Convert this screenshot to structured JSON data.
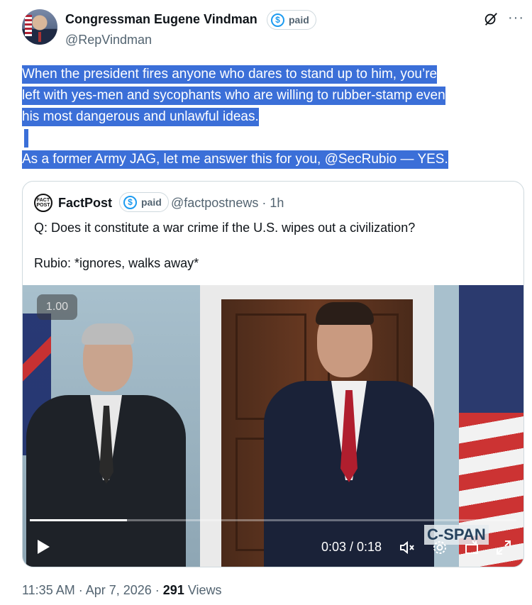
{
  "author": {
    "name": "Congressman Eugene Vindman",
    "badge_label": "paid",
    "badge_symbol": "$",
    "handle": "@RepVindman"
  },
  "tweet": {
    "lines": [
      "When the president fires anyone who dares to stand up to him, you’re",
      "left with yes-men and sycophants who are willing to rubber-stamp even",
      "his most dangerous and unlawful ideas.",
      " ",
      "As a former Army JAG, let me answer this for you, @SecRubio — YES."
    ]
  },
  "quote": {
    "logo_text_top": "FACT",
    "logo_text_bottom": "POST",
    "name": "FactPost",
    "badge_label": "paid",
    "badge_symbol": "$",
    "handle_time": "@factpostnews · 1h",
    "text_line_1": "Q: Does it constitute a war crime if the U.S. wipes out a civilization?",
    "text_line_2": "Rubio: *ignores, walks away*"
  },
  "video": {
    "speed_label": "1.00",
    "watermark": "C-SPAN",
    "time": "0:03 / 0:18",
    "progress_fraction": 0.2
  },
  "meta": {
    "timestamp": "11:35 AM · Apr 7, 2026 · ",
    "views_count": "291",
    "views_label": " Views"
  },
  "colors": {
    "selection": "#3b6fd8",
    "accent": "#1d9bf0",
    "muted": "#536471"
  },
  "icons": [
    "grok-icon",
    "more-icon",
    "play-icon",
    "volume-muted-icon",
    "settings-icon",
    "pip-icon",
    "fullscreen-icon"
  ]
}
